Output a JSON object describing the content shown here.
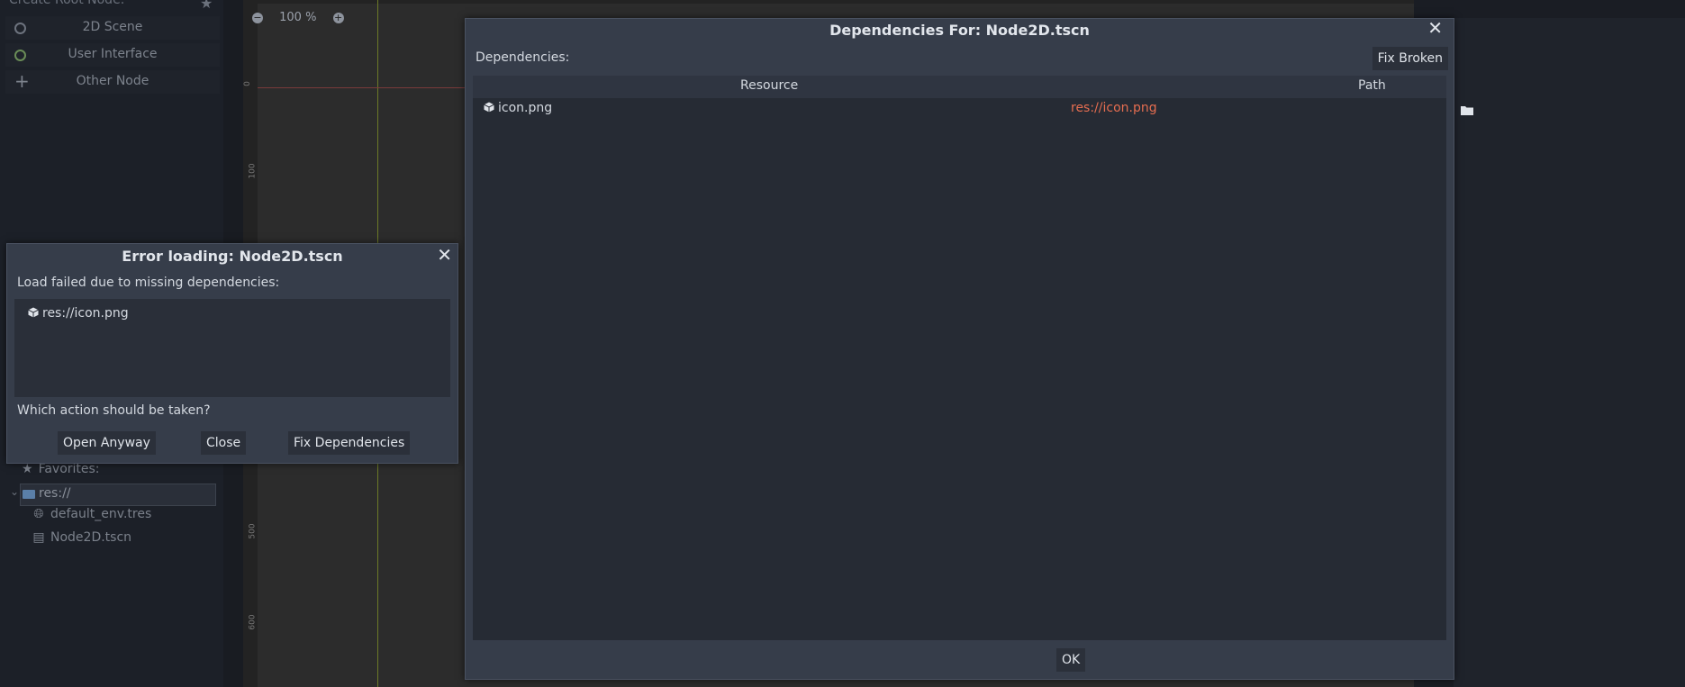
{
  "left_dock": {
    "root_title": "Create Root Node:",
    "items": [
      {
        "label": "2D Scene"
      },
      {
        "label": "User Interface"
      },
      {
        "label": "Other Node"
      }
    ]
  },
  "filesystem": {
    "favorites_label": "Favorites:",
    "root": "res://",
    "files": [
      "default_env.tres",
      "Node2D.tscn"
    ]
  },
  "viewport": {
    "zoom_label": "100 %",
    "ruler_labels": [
      "0",
      "100",
      "500",
      "600"
    ]
  },
  "error_dialog": {
    "title": "Error loading: Node2D.tscn",
    "message": "Load failed due to missing dependencies:",
    "missing": [
      "res://icon.png"
    ],
    "question": "Which action should be taken?",
    "buttons": {
      "open_anyway": "Open Anyway",
      "close": "Close",
      "fix": "Fix Dependencies"
    }
  },
  "deps_dialog": {
    "title": "Dependencies For: Node2D.tscn",
    "label": "Dependencies:",
    "fix_broken": "Fix Broken",
    "columns": {
      "resource": "Resource",
      "path": "Path"
    },
    "rows": [
      {
        "resource": "icon.png",
        "path": "res://icon.png"
      }
    ],
    "ok": "OK"
  },
  "colors": {
    "broken_path": "#e56d50",
    "dialog_bg": "#363d4a",
    "editor_bg": "#1c2028"
  }
}
